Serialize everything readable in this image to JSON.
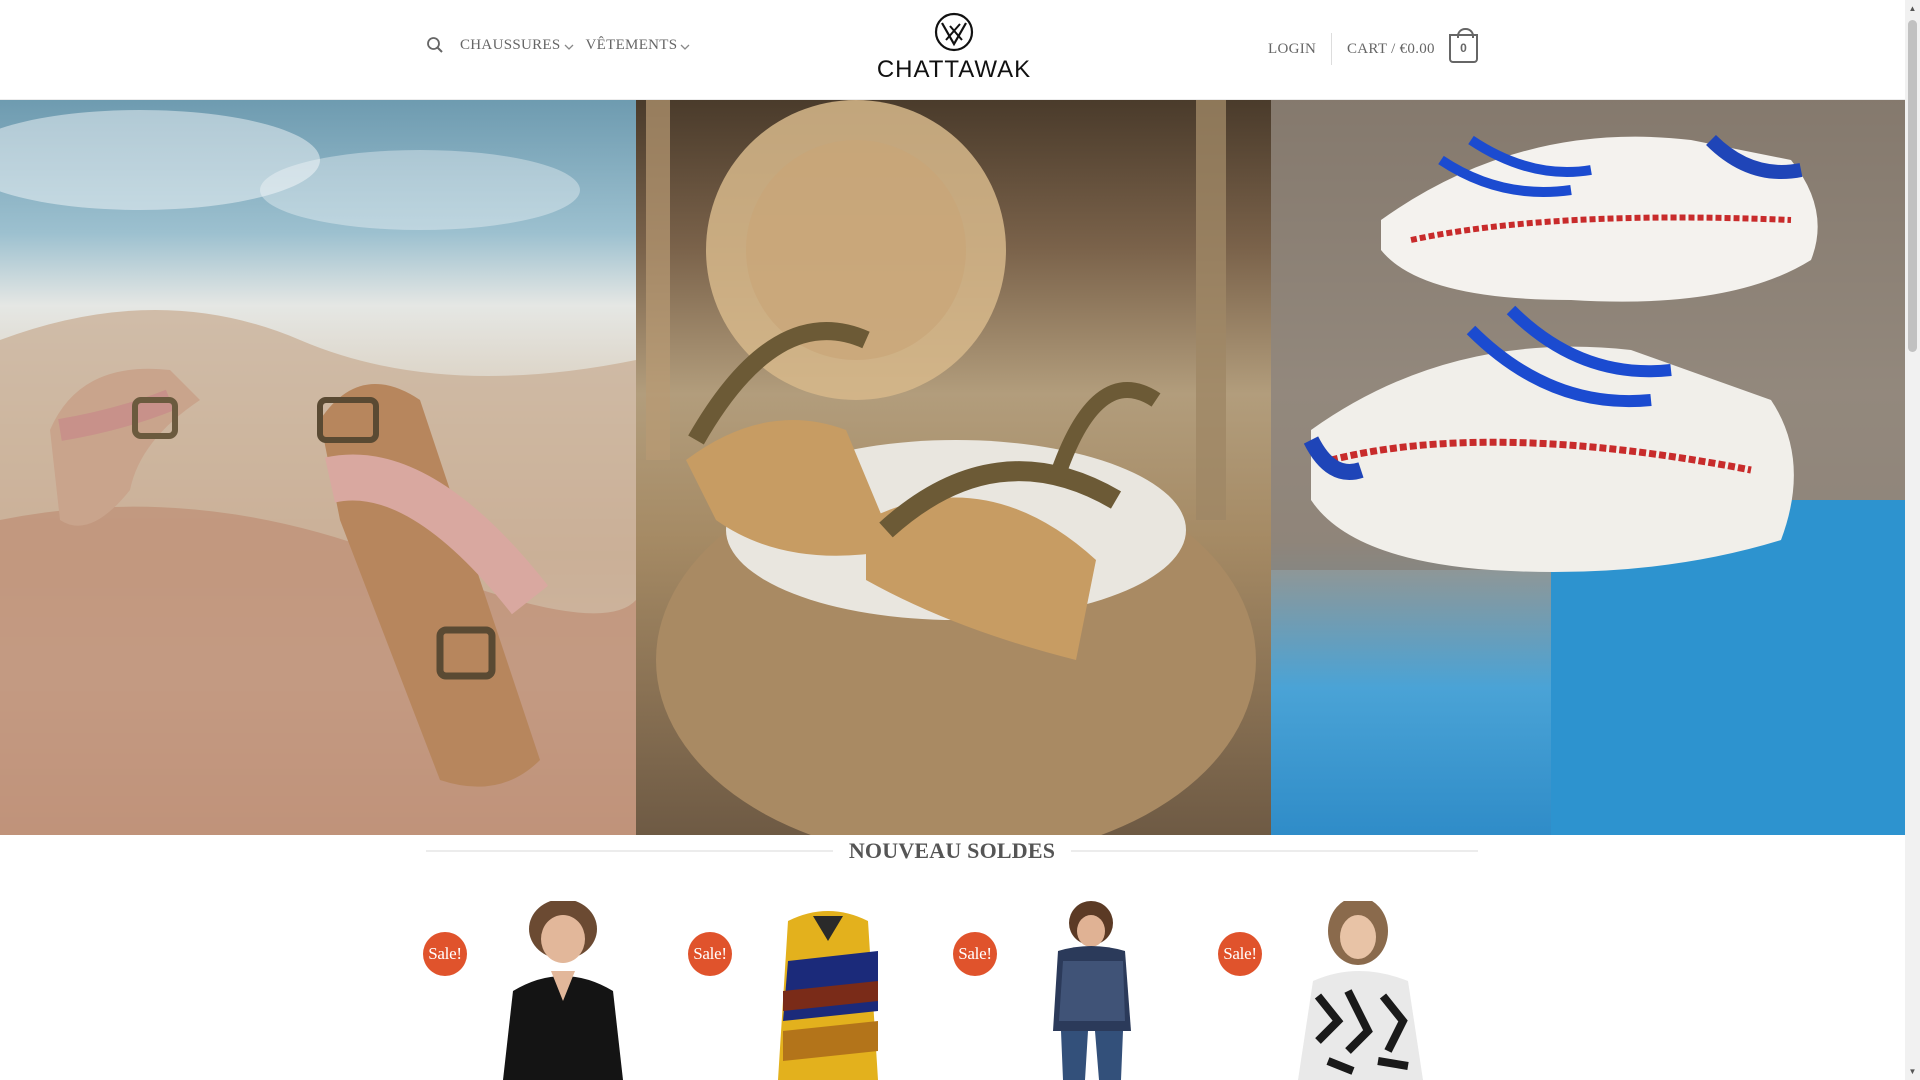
{
  "header": {
    "nav_left": [
      {
        "label": "CHAUSSURES"
      },
      {
        "label": "VÊTEMENTS"
      }
    ],
    "logo_text": "CHATTAWAK",
    "login_label": "LOGIN",
    "cart_label": "CART / €0.00",
    "cart_count": "0"
  },
  "section": {
    "title": "NOUVEAU SOLDES"
  },
  "products": [
    {
      "badge": "Sale!"
    },
    {
      "badge": "Sale!"
    },
    {
      "badge": "Sale!"
    },
    {
      "badge": "Sale!"
    }
  ],
  "colors": {
    "sale_badge": "#e0532c",
    "text_muted": "#666666",
    "title": "#555555"
  },
  "icons": [
    "search-icon",
    "chevron-down-icon",
    "logo-icon",
    "cart-icon"
  ]
}
